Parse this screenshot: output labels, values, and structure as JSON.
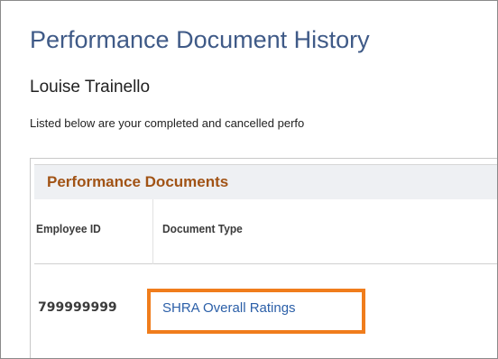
{
  "page": {
    "title": "Performance Document History",
    "employee_name": "Louise Trainello",
    "intro_text": "Listed below are your completed and cancelled perfo"
  },
  "grid": {
    "title": "Performance Documents",
    "columns": [
      "Employee ID",
      "Document Type"
    ],
    "rows": [
      {
        "employee_id": "799999999",
        "document_type": "SHRA Overall Ratings"
      }
    ]
  },
  "colors": {
    "title_blue": "#3f5a87",
    "grid_title_orange": "#a15315",
    "link_blue": "#2b5fa8",
    "highlight_orange": "#f07d1c"
  }
}
